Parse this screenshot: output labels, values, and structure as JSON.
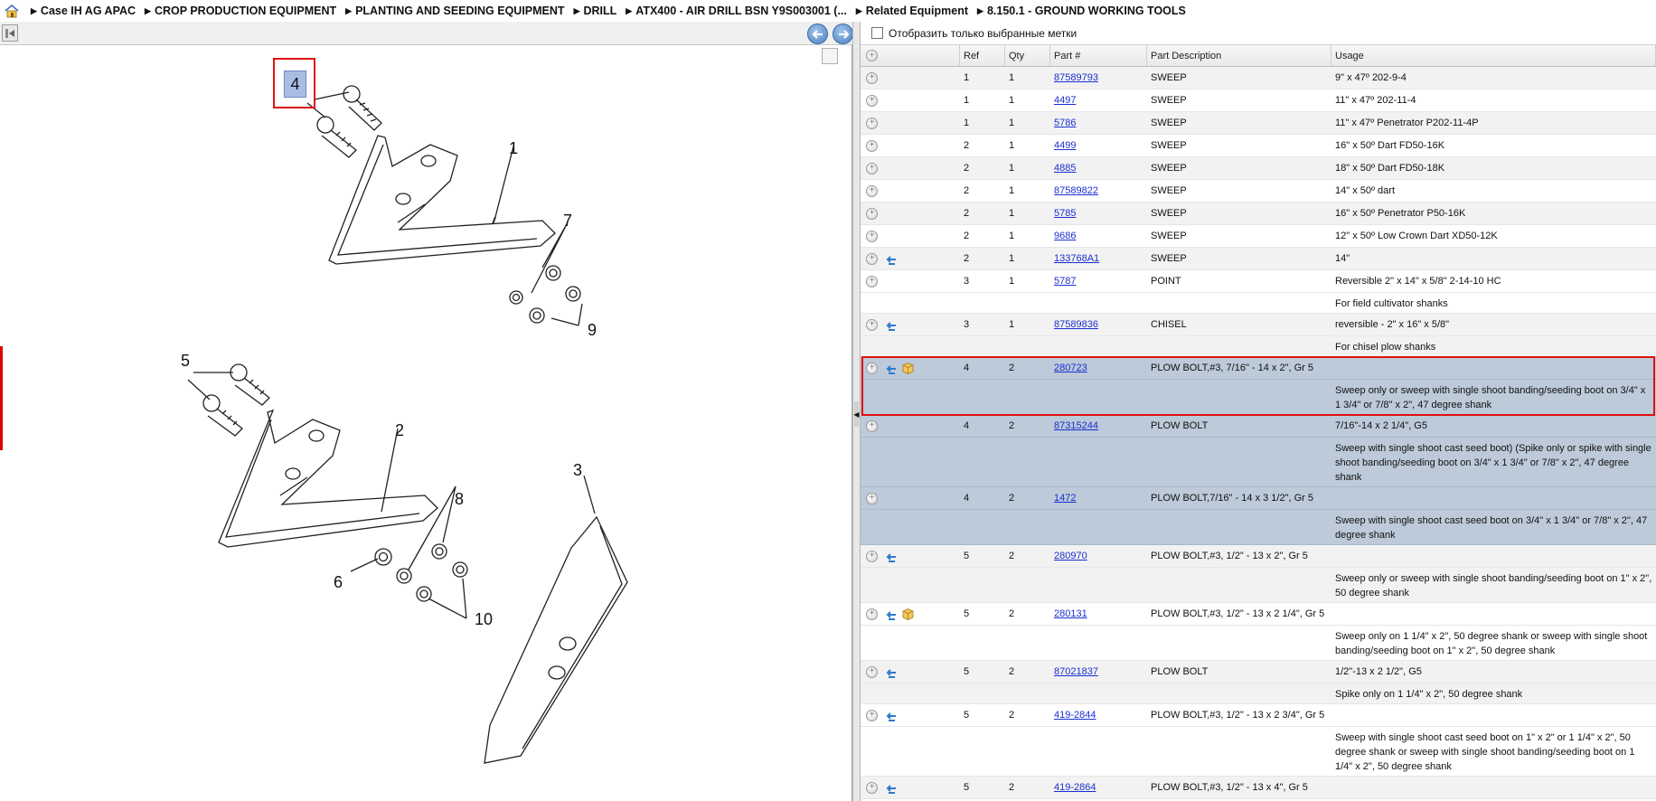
{
  "breadcrumb": [
    "Case IH AG APAC",
    "CROP PRODUCTION EQUIPMENT",
    "PLANTING AND SEEDING EQUIPMENT",
    "DRILL",
    "ATX400 - AIR DRILL BSN Y9S003001 (...",
    "Related Equipment",
    "8.150.1 - GROUND WORKING TOOLS"
  ],
  "filter": {
    "label": "Отобразить только выбранные метки"
  },
  "columns": {
    "ref": "Ref",
    "qty": "Qty",
    "part": "Part #",
    "desc": "Part Description",
    "usage": "Usage"
  },
  "drawing": {
    "callouts": [
      "4",
      "1",
      "7",
      "9",
      "5",
      "2",
      "8",
      "6",
      "10",
      "3"
    ]
  },
  "rows": [
    {
      "ref": "1",
      "qty": "1",
      "part": "87589793",
      "desc": "SWEEP",
      "usage": "9\" x 47º 202-9-4",
      "icons": []
    },
    {
      "ref": "1",
      "qty": "1",
      "part": "4497",
      "desc": "SWEEP",
      "usage": "11\" x 47º 202-11-4",
      "icons": []
    },
    {
      "ref": "1",
      "qty": "1",
      "part": "5786",
      "desc": "SWEEP",
      "usage": "11\" x 47º Penetrator P202-11-4P",
      "icons": []
    },
    {
      "ref": "2",
      "qty": "1",
      "part": "4499",
      "desc": "SWEEP",
      "usage": "16\" x 50º Dart FD50-16K",
      "icons": []
    },
    {
      "ref": "2",
      "qty": "1",
      "part": "4885",
      "desc": "SWEEP",
      "usage": "18\" x 50º Dart FD50-18K",
      "icons": []
    },
    {
      "ref": "2",
      "qty": "1",
      "part": "87589822",
      "desc": "SWEEP",
      "usage": "14\" x 50º dart",
      "icons": []
    },
    {
      "ref": "2",
      "qty": "1",
      "part": "5785",
      "desc": "SWEEP",
      "usage": "16\" x 50º Penetrator P50-16K",
      "icons": []
    },
    {
      "ref": "2",
      "qty": "1",
      "part": "9686",
      "desc": "SWEEP",
      "usage": "12\" x 50º Low Crown Dart XD50-12K",
      "icons": []
    },
    {
      "ref": "2",
      "qty": "1",
      "part": "133768A1",
      "desc": "SWEEP",
      "usage": "14\"",
      "icons": [
        "swap"
      ]
    },
    {
      "ref": "3",
      "qty": "1",
      "part": "5787",
      "desc": "POINT",
      "usage": "Reversible 2\" x 14\" x 5/8\" 2-14-10 HC",
      "icons": []
    },
    {
      "note": "For field cultivator shanks"
    },
    {
      "ref": "3",
      "qty": "1",
      "part": "87589836",
      "desc": "CHISEL",
      "usage": "reversible - 2\" x 16\" x 5/8\"",
      "icons": [
        "swap"
      ]
    },
    {
      "note": "For chisel plow shanks"
    },
    {
      "ref": "4",
      "qty": "2",
      "part": "280723",
      "desc": "PLOW BOLT,#3, 7/16\" - 14 x 2\", Gr 5",
      "usage": "",
      "icons": [
        "swap",
        "box"
      ],
      "selected": true
    },
    {
      "note": "Sweep only or sweep with single shoot banding/seeding boot on 3/4\" x 1 3/4\" or 7/8\" x 2\", 47 degree shank",
      "selected": true
    },
    {
      "ref": "4",
      "qty": "2",
      "part": "87315244",
      "desc": "PLOW BOLT",
      "usage": "7/16\"-14 x 2 1/4\", G5",
      "icons": [],
      "selected": true
    },
    {
      "note": "Sweep with single shoot cast seed boot) (Spike only or spike with single shoot banding/seeding boot on 3/4\" x 1 3/4\" or 7/8\" x 2\", 47 degree shank",
      "selected": true
    },
    {
      "ref": "4",
      "qty": "2",
      "part": "1472",
      "desc": "PLOW BOLT,7/16\" - 14 x 3 1/2\", Gr 5",
      "usage": "",
      "icons": [],
      "selected": true
    },
    {
      "note": "Sweep with single shoot cast seed boot on 3/4\" x 1 3/4\" or 7/8\" x 2\", 47 degree shank",
      "selected": true
    },
    {
      "ref": "5",
      "qty": "2",
      "part": "280970",
      "desc": "PLOW BOLT,#3, 1/2\" - 13 x 2\", Gr 5",
      "usage": "",
      "icons": [
        "swap"
      ]
    },
    {
      "note": "Sweep only or sweep with single shoot banding/seeding boot on 1\" x 2\", 50 degree shank"
    },
    {
      "ref": "5",
      "qty": "2",
      "part": "280131",
      "desc": "PLOW BOLT,#3, 1/2\" - 13 x 2 1/4\", Gr 5",
      "usage": "",
      "icons": [
        "swap",
        "box"
      ]
    },
    {
      "note": "Sweep only on 1 1/4\" x 2\", 50 degree shank or sweep with single shoot banding/seeding boot on 1\" x 2\", 50 degree shank"
    },
    {
      "ref": "5",
      "qty": "2",
      "part": "87021837",
      "desc": "PLOW BOLT",
      "usage": "1/2\"-13 x 2 1/2\", G5",
      "icons": [
        "swap"
      ]
    },
    {
      "note": "Spike only on 1 1/4\" x 2\", 50 degree shank"
    },
    {
      "ref": "5",
      "qty": "2",
      "part": "419-2844",
      "desc": "PLOW BOLT,#3, 1/2\" - 13 x 2 3/4\", Gr 5",
      "usage": "",
      "icons": [
        "swap"
      ]
    },
    {
      "note": "Sweep with single shoot cast seed boot on 1\" x 2\" or 1 1/4\" x 2\", 50 degree shank or sweep with single shoot banding/seeding boot on 1 1/4\" x 2\", 50 degree shank"
    },
    {
      "ref": "5",
      "qty": "2",
      "part": "419-2864",
      "desc": "PLOW BOLT,#3, 1/2\" - 13 x 4\", Gr 5",
      "usage": "",
      "icons": [
        "swap"
      ]
    }
  ]
}
